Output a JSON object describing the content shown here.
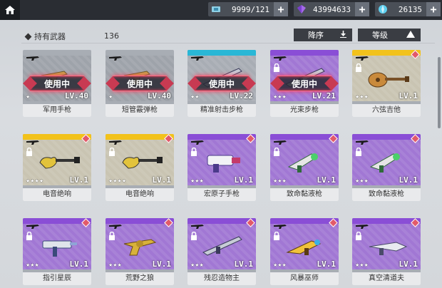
{
  "topbar": {
    "resources": [
      {
        "icon": "ticket-icon",
        "value": "9999/121"
      },
      {
        "icon": "purple-crystal-icon",
        "value": "43994633"
      },
      {
        "icon": "blue-gem-icon",
        "value": "26135"
      }
    ]
  },
  "header": {
    "title": "持有武器",
    "count": "136",
    "sort_label": "降序",
    "filter_label": "等级"
  },
  "cards": [
    {
      "name": "军用手枪",
      "lv": "LV.40",
      "stars": "★",
      "in_use": "使用中",
      "rarity": "grey"
    },
    {
      "name": "短管霰弹枪",
      "lv": "LV.40",
      "stars": "★",
      "in_use": "使用中",
      "rarity": "grey"
    },
    {
      "name": "精准射击步枪",
      "lv": "LV.22",
      "stars": "★★",
      "in_use": "使用中",
      "rarity": "blue"
    },
    {
      "name": "光束步枪",
      "lv": "LV.21",
      "stars": "★★★",
      "in_use": "使用中",
      "rarity": "purple"
    },
    {
      "name": "六弦吉他",
      "lv": "LV.1",
      "stars": "★★★",
      "in_use": "",
      "rarity": "yellow"
    },
    {
      "name": "电音绝响",
      "lv": "LV.1",
      "stars": "★★★★",
      "in_use": "",
      "rarity": "yellow"
    },
    {
      "name": "电音绝响",
      "lv": "LV.1",
      "stars": "★★★★",
      "in_use": "",
      "rarity": "yellow"
    },
    {
      "name": "宏原子手枪",
      "lv": "LV.1",
      "stars": "★★★",
      "in_use": "",
      "rarity": "purple"
    },
    {
      "name": "致命黏液枪",
      "lv": "LV.1",
      "stars": "★★★",
      "in_use": "",
      "rarity": "purple"
    },
    {
      "name": "致命黏液枪",
      "lv": "LV.1",
      "stars": "★★★",
      "in_use": "",
      "rarity": "purple"
    },
    {
      "name": "指引星辰",
      "lv": "LV.1",
      "stars": "★★★",
      "in_use": "",
      "rarity": "purple"
    },
    {
      "name": "荒野之狼",
      "lv": "LV.1",
      "stars": "★★★",
      "in_use": "",
      "rarity": "purple"
    },
    {
      "name": "残忍造物主",
      "lv": "LV.1",
      "stars": "★★★",
      "in_use": "",
      "rarity": "purple"
    },
    {
      "name": "风暴巫师",
      "lv": "LV.1",
      "stars": "★★★",
      "in_use": "",
      "rarity": "purple"
    },
    {
      "name": "真空清道夫",
      "lv": "LV.1",
      "stars": "★★★",
      "in_use": "",
      "rarity": "purple"
    }
  ]
}
